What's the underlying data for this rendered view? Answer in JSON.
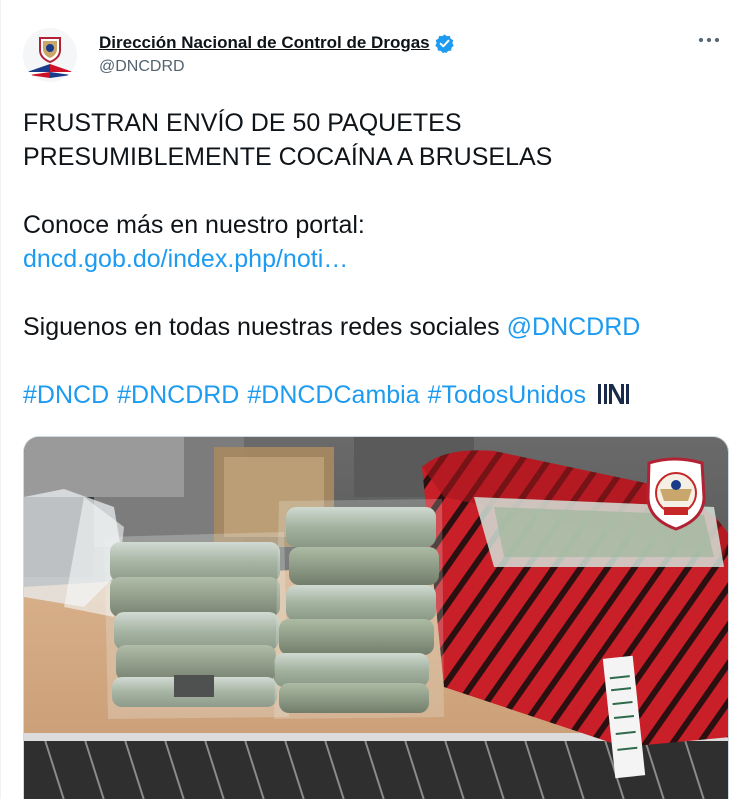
{
  "author": {
    "display_name": "Dirección Nacional de Control de Drogas",
    "handle": "@DNCDRD",
    "verified": true,
    "verified_badge_color": "#1d9bf0",
    "avatar_icon": "dncd-shield-logo-icon"
  },
  "menu": {
    "icon": "more-options-icon"
  },
  "tweet": {
    "headline_line1": "FRUSTRAN ENVÍO DE 50 PAQUETES",
    "headline_line2": "PRESUMIBLEMENTE COCAÍNA A BRUSELAS",
    "portal_text": "Conoce más en nuestro portal:",
    "portal_link": "dncd.gob.do/index.php/noti…",
    "follow_text": "Siguenos en todas nuestras redes sociales ",
    "follow_mention": "@DNCDRD",
    "hashtags": [
      "#DNCD",
      "#DNCDRD",
      "#DNCDCambia",
      "#TodosUnidos"
    ],
    "hashtag_emoji_icon": "todos-unidos-n-icon"
  },
  "media": {
    "content_icon": "seized-packages-photo-icon",
    "watermark_icon": "dncd-badge-icon"
  },
  "colors": {
    "text": "#0f1419",
    "secondary": "#536471",
    "link": "#1d9bf0",
    "border": "#cfd9de"
  }
}
